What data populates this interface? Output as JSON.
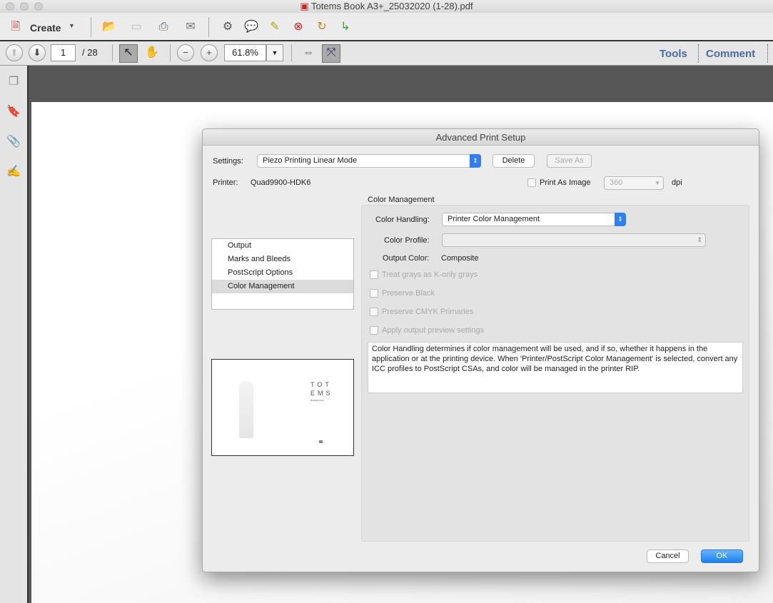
{
  "window": {
    "title": "Totems Book A3+_25032020 (1-28).pdf"
  },
  "toolbar": {
    "create_label": "Create",
    "page_current": "1",
    "page_total": "/ 28",
    "zoom": "61.8%",
    "tools_label": "Tools",
    "comment_label": "Comment"
  },
  "dialog": {
    "title": "Advanced Print Setup",
    "settings_label": "Settings:",
    "settings_value": "Piezo Printing Linear Mode",
    "delete_label": "Delete",
    "save_as_label": "Save As",
    "printer_label": "Printer:",
    "printer_value": "Quad9900-HDK6",
    "print_as_image_label": "Print As Image",
    "dpi_value": "360",
    "dpi_label": "dpi",
    "section_title": "Color Management",
    "nav": [
      "Output",
      "Marks and Bleeds",
      "PostScript Options",
      "Color Management"
    ],
    "preview": {
      "title_line1": "TOT",
      "title_line2": "EMS",
      "subtitle": "BARCELONA"
    },
    "color_handling_label": "Color Handling:",
    "color_handling_value": "Printer Color Management",
    "color_profile_label": "Color Profile:",
    "color_profile_value": "",
    "output_color_label": "Output Color:",
    "output_color_value": "Composite",
    "checkboxes": [
      "Treat grays as K-only grays",
      "Preserve Black",
      "Preserve CMYK Primaries",
      "Apply output preview settings"
    ],
    "help_text": "Color Handling determines if color management will be used, and if so, whether it happens in the application or at the printing device. When 'Printer/PostScript Color Management' is selected, convert any ICC profiles to PostScript CSAs, and color will be managed in the printer RIP.",
    "cancel_label": "Cancel",
    "ok_label": "OK"
  }
}
